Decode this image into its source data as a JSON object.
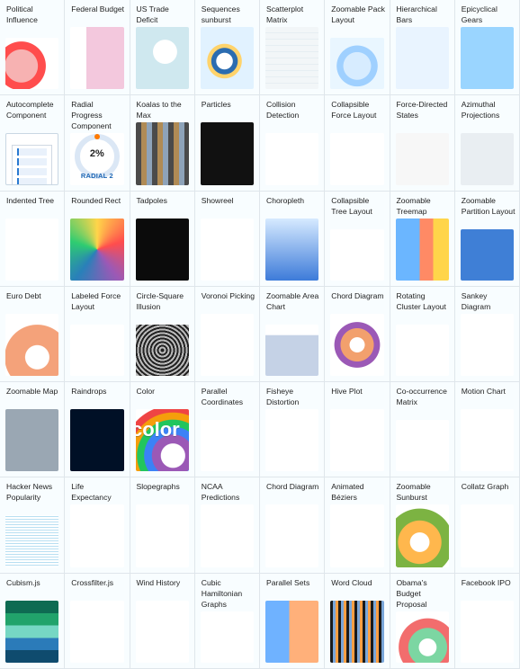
{
  "left_tiles": [
    {
      "title": "Political Influence",
      "thumb": "t-red"
    },
    {
      "title": "Federal Budget",
      "thumb": "t-budget"
    },
    {
      "title": "US Trade Deficit",
      "thumb": "t-trade"
    },
    {
      "title": "Sequences sunburst",
      "thumb": "t-sunburst"
    },
    {
      "title": "Autocomplete Component",
      "thumb": "t-auto"
    },
    {
      "title": "Radial Progress Component",
      "thumb": "t-radial",
      "center": "2%",
      "label": "RADIAL 2"
    },
    {
      "title": "Koalas to the Max",
      "thumb": "t-koalas"
    },
    {
      "title": "Particles",
      "thumb": "t-particles"
    },
    {
      "title": "Indented Tree",
      "thumb": "t-indent"
    },
    {
      "title": "Rounded Rect",
      "thumb": "t-rrect"
    },
    {
      "title": "Tadpoles",
      "thumb": "t-tadpoles"
    },
    {
      "title": "Showreel",
      "thumb": "t-showreel"
    },
    {
      "title": "Euro Debt",
      "thumb": "t-euro"
    },
    {
      "title": "Labeled Force Layout",
      "thumb": "t-labeled"
    },
    {
      "title": "Circle-Square Illusion",
      "thumb": "t-circsq"
    },
    {
      "title": "Voronoi Picking",
      "thumb": "t-voronoi"
    },
    {
      "title": "Zoomable Map",
      "thumb": "t-zmap"
    },
    {
      "title": "Raindrops",
      "thumb": "t-rain"
    },
    {
      "title": "Color",
      "thumb": "t-color",
      "word": "color"
    },
    {
      "title": "Parallel Coordinates",
      "thumb": "t-pcoords"
    },
    {
      "title": "Hacker News Popularity",
      "thumb": "t-hn"
    },
    {
      "title": "Life Expectancy",
      "thumb": "t-life"
    },
    {
      "title": "Slopegraphs",
      "thumb": "t-slope"
    },
    {
      "title": "NCAA Predictions",
      "thumb": "t-ncaa"
    },
    {
      "title": "Cubism.js",
      "thumb": "t-cubism"
    },
    {
      "title": "Crossfilter.js",
      "thumb": "t-xfilter"
    },
    {
      "title": "Wind History",
      "thumb": "t-wind"
    },
    {
      "title": "Cubic Hamiltonian Graphs",
      "thumb": "t-cubic"
    }
  ],
  "right_tiles": [
    {
      "title": "Scatterplot Matrix",
      "thumb": "t-scatter"
    },
    {
      "title": "Zoomable Pack Layout",
      "thumb": "t-pack"
    },
    {
      "title": "Hierarchical Bars",
      "thumb": "t-bars"
    },
    {
      "title": "Epicyclical Gears",
      "thumb": "t-gears"
    },
    {
      "title": "Collision Detection",
      "thumb": "t-collision"
    },
    {
      "title": "Collapsible Force Layout",
      "thumb": "t-force"
    },
    {
      "title": "Force-Directed States",
      "thumb": "t-states"
    },
    {
      "title": "Azimuthal Projections",
      "thumb": "t-azimuthal"
    },
    {
      "title": "Choropleth",
      "thumb": "t-choro"
    },
    {
      "title": "Collapsible Tree Layout",
      "thumb": "t-coltree"
    },
    {
      "title": "Zoomable Treemap",
      "thumb": "t-treemap"
    },
    {
      "title": "Zoomable Partition Layout",
      "thumb": "t-partition"
    },
    {
      "title": "Zoomable Area Chart",
      "thumb": "t-area"
    },
    {
      "title": "Chord Diagram",
      "thumb": "t-chord"
    },
    {
      "title": "Rotating Cluster Layout",
      "thumb": "t-rotclust"
    },
    {
      "title": "Sankey Diagram",
      "thumb": "t-sankey"
    },
    {
      "title": "Fisheye Distortion",
      "thumb": "t-fisheye"
    },
    {
      "title": "Hive Plot",
      "thumb": "t-hive"
    },
    {
      "title": "Co-occurrence Matrix",
      "thumb": "t-cooc"
    },
    {
      "title": "Motion Chart",
      "thumb": "t-motion"
    },
    {
      "title": "Chord Diagram",
      "thumb": "t-chord2"
    },
    {
      "title": "Animated Béziers",
      "thumb": "t-bez"
    },
    {
      "title": "Zoomable Sunburst",
      "thumb": "t-zsun"
    },
    {
      "title": "Collatz Graph",
      "thumb": "t-collatz"
    },
    {
      "title": "Parallel Sets",
      "thumb": "t-psets"
    },
    {
      "title": "Word Cloud",
      "thumb": "t-cloud"
    },
    {
      "title": "Obama's Budget Proposal",
      "thumb": "t-obama"
    },
    {
      "title": "Facebook IPO",
      "thumb": "t-fbipo"
    }
  ]
}
